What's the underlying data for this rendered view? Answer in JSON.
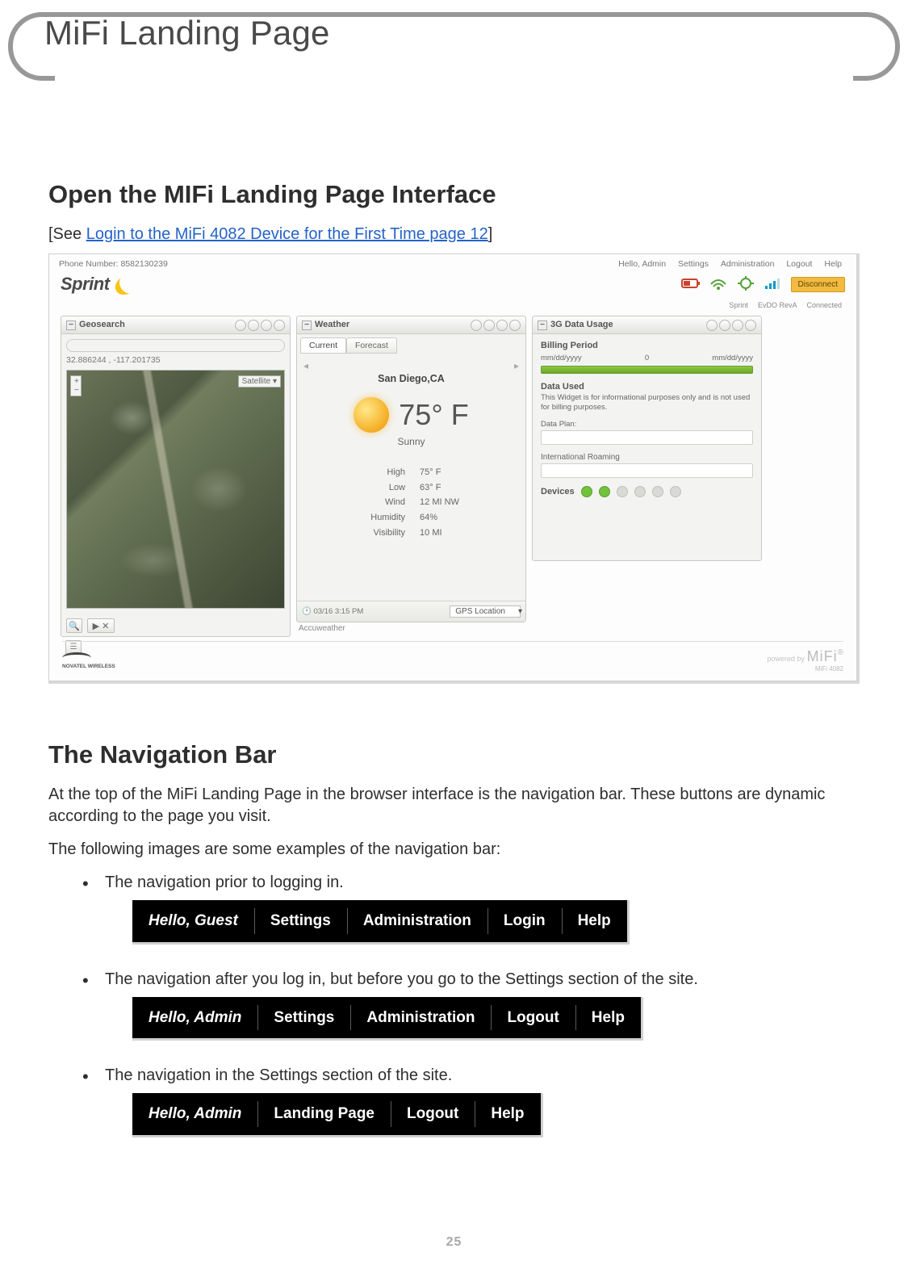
{
  "page_number": "25",
  "title_frame": "MiFi Landing Page",
  "section_open": {
    "heading": "Open the MIFi Landing Page Interface",
    "see_prefix": "[See ",
    "see_link": "Login to the MiFi 4082 Device for the First Time  page 12",
    "see_suffix": "]"
  },
  "screenshot": {
    "phone_label": "Phone Number:",
    "phone_value": "8582130239",
    "greeting": "Hello, Admin",
    "menu": {
      "settings": "Settings",
      "admin": "Administration",
      "logout": "Logout",
      "help": "Help"
    },
    "brand": "Sprint",
    "status": {
      "net": "Sprint",
      "tech": "EvDO RevA",
      "conn": "Connected"
    },
    "disconnect": "Disconnect",
    "geosearch": {
      "title": "Geosearch",
      "coords": "32.886244 , -117.201735",
      "satellite": "Satellite  ▾"
    },
    "weather": {
      "title": "Weather",
      "tab_current": "Current",
      "tab_forecast": "Forecast",
      "city": "San Diego,CA",
      "temp": "75° F",
      "cond": "Sunny",
      "high_lbl": "High",
      "high_val": "75° F",
      "low_lbl": "Low",
      "low_val": "63° F",
      "wind_lbl": "Wind",
      "wind_val": "12 MI NW",
      "hum_lbl": "Humidity",
      "hum_val": "64%",
      "vis_lbl": "Visibility",
      "vis_val": "10 MI",
      "time": "03/16 3:15 PM",
      "selector": "GPS Location",
      "provider": "Accuweather"
    },
    "usage": {
      "title": "3G Data Usage",
      "billing_period": "Billing Period",
      "from": "mm/dd/yyyy",
      "mid": "0",
      "to": "mm/dd/yyyy",
      "data_used": "Data Used",
      "note": "This Widget is for informational purposes only and is not used for billing purposes.",
      "data_plan": "Data Plan:",
      "roaming": "International Roaming",
      "devices": "Devices"
    },
    "footer_brand": "NOVATEL WIRELESS",
    "powered_by": "powered by",
    "mifi": "MiFi",
    "model": "MiFi  4082"
  },
  "section_nav": {
    "heading": "The Navigation Bar",
    "intro": "At the top of the MiFi Landing Page in the browser interface is the navigation bar. These buttons are dynamic according to the page you visit.",
    "examples_intro": "The following images are some examples of the navigation bar:",
    "bullets": [
      "The navigation prior to logging in.",
      "The navigation after you log in, but before you go to the Settings section of the site.",
      "The navigation in the Settings section of the site."
    ]
  },
  "nav1": {
    "greet": "Hello, Guest",
    "a": "Settings",
    "b": "Administration",
    "c": "Login",
    "d": "Help"
  },
  "nav2": {
    "greet": "Hello, Admin",
    "a": "Settings",
    "b": "Administration",
    "c": "Logout",
    "d": "Help"
  },
  "nav3": {
    "greet": "Hello, Admin",
    "a": "Landing Page",
    "b": "Logout",
    "c": "Help"
  }
}
